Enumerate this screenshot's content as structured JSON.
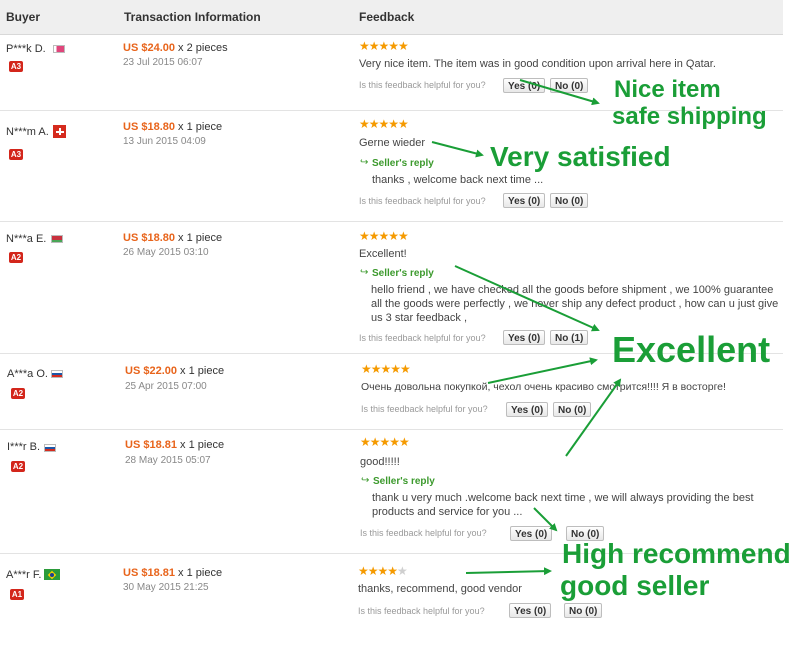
{
  "header": {
    "buyer": "Buyer",
    "transaction": "Transaction Information",
    "feedback": "Feedback"
  },
  "helpful_question": "Is this feedback helpful for you?",
  "reply_label": "Seller's reply",
  "reviews": [
    {
      "buyer": "P***k D.",
      "flag": "qatar-flag",
      "level": "A3",
      "price": "US $24.00",
      "qty": "x 2 pieces",
      "date": "23 Jul 2015 06:07",
      "stars": 5,
      "comment": "Very nice item. The item was in good condition upon arrival here in Qatar.",
      "reply": "",
      "yes": "Yes (0)",
      "no": "No (0)"
    },
    {
      "buyer": "N***m A.",
      "flag": "switzerland-flag",
      "level": "A3",
      "price": "US $18.80",
      "qty": "x 1 piece",
      "date": "13 Jun 2015 04:09",
      "stars": 5,
      "comment": "Gerne wieder",
      "reply": "thanks , welcome back next time ...",
      "yes": "Yes (0)",
      "no": "No (0)"
    },
    {
      "buyer": "N***a E.",
      "flag": "belarus-flag",
      "level": "A2",
      "price": "US $18.80",
      "qty": "x 1 piece",
      "date": "26 May 2015 03:10",
      "stars": 5,
      "comment": "Excellent!",
      "reply": "hello friend , we have checked all the goods before shipment , we 100% guarantee all the goods were perfectly , we never ship any defect product , how can u just give us 3 star feedback ,",
      "yes": "Yes (0)",
      "no": "No (1)"
    },
    {
      "buyer": "A***a O.",
      "flag": "russia-flag",
      "level": "A2",
      "price": "US $22.00",
      "qty": "x 1 piece",
      "date": "25 Apr 2015 07:00",
      "stars": 5,
      "comment": "Очень довольна покупкой, чехол очень красиво смотрится!!!! Я в восторге!",
      "reply": "",
      "yes": "Yes (0)",
      "no": "No (0)"
    },
    {
      "buyer": "I***r B.",
      "flag": "russia-flag",
      "level": "A2",
      "price": "US $18.81",
      "qty": "x 1 piece",
      "date": "28 May 2015 05:07",
      "stars": 5,
      "comment": "good!!!!!",
      "reply": "thank u very much .welcome back next time , we will always providing the best products and service for you ...",
      "yes": "Yes (0)",
      "no": "No (0)"
    },
    {
      "buyer": "A***r F.",
      "flag": "brazil-flag",
      "level": "A1",
      "price": "US $18.81",
      "qty": "x 1 piece",
      "date": "30 May 2015 21:25",
      "stars": 4,
      "comment": "thanks, recommend, good vendor",
      "reply": "",
      "yes": "Yes (0)",
      "no": "No (0)"
    }
  ],
  "annotations": {
    "nice_item_1": "Nice item",
    "nice_item_2": "safe shipping",
    "very_satisfied": "Very satisfied",
    "excellent": "Excellent",
    "high_recommend_1": "High recommend",
    "high_recommend_2": "good seller"
  },
  "colors": {
    "price": "#e8641b",
    "stars": "#f59a00",
    "badge": "#d3261b",
    "reply": "#3c9a2d",
    "annotation": "#1a9e37"
  }
}
